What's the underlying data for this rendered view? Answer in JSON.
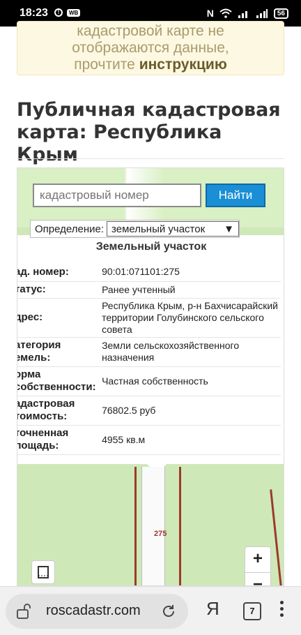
{
  "status_bar": {
    "time": "18:23",
    "app_badge": "WB",
    "battery": "56"
  },
  "banner": {
    "line1": "кадастровой карте не",
    "line2": "отображаются данные,",
    "line3_prefix": "прочтите ",
    "line3_bold": "инструкцию"
  },
  "page_title": "Публичная кадастровая карта: Республика Крым",
  "search": {
    "placeholder": "кадастровый номер",
    "button": "Найти"
  },
  "definition": {
    "label": "Определение:",
    "selected": "земельный участок"
  },
  "info": {
    "title": "Земельный участок",
    "rows": [
      {
        "key_lines": [
          "ад. номер:"
        ],
        "value_lines": [
          "90:01:071101:275"
        ]
      },
      {
        "key_lines": [
          "татус:"
        ],
        "value_lines": [
          "Ранее учтенный"
        ]
      },
      {
        "key_lines": [
          "дрес:"
        ],
        "value_lines": [
          "Республика Крым, р-н Бахчисарайский",
          "территории Голубинского сельского",
          "совета"
        ]
      },
      {
        "key_lines": [
          "атегория",
          "емель:"
        ],
        "value_lines": [
          "Земли сельскохозяйственного",
          "назначения"
        ]
      },
      {
        "key_lines": [
          "орма",
          "собственности:"
        ],
        "value_lines": [
          "Частная собственность"
        ]
      },
      {
        "key_lines": [
          "адастровая",
          "тоимость:"
        ],
        "value_lines": [
          "76802.5 руб"
        ]
      },
      {
        "key_lines": [
          "точненная",
          "лощадь:"
        ],
        "value_lines": [
          "4955 кв.м"
        ]
      }
    ]
  },
  "map": {
    "parcel_label": "275",
    "zoom_in": "+",
    "zoom_out": "−"
  },
  "browser": {
    "url": "roscadastr.com",
    "ya": "Я",
    "tab_count": "7"
  }
}
